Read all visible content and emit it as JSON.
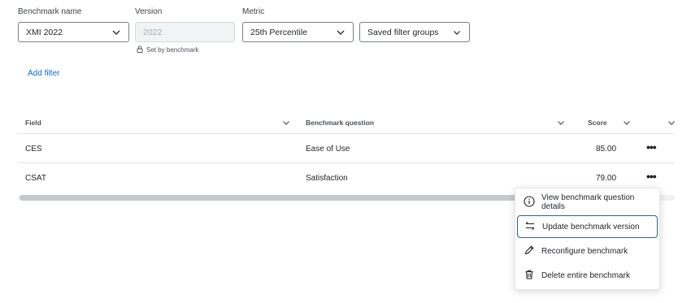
{
  "filters": {
    "benchmark_label": "Benchmark name",
    "benchmark_value": "XMI 2022",
    "version_label": "Version",
    "version_value": "2022",
    "version_note": "Set by benchmark",
    "metric_label": "Metric",
    "metric_value": "25th Percentile",
    "filter_groups_value": "Saved filter groups",
    "add_filter": "Add filter"
  },
  "table": {
    "headers": {
      "field": "Field",
      "question": "Benchmark question",
      "score": "Score"
    },
    "rows": [
      {
        "field": "CES",
        "question": "Ease of Use",
        "score": "85.00",
        "actions": "•••"
      },
      {
        "field": "CSAT",
        "question": "Satisfaction",
        "score": "79.00",
        "actions": "•••"
      }
    ]
  },
  "menu": {
    "items": [
      {
        "label": "View benchmark question details",
        "icon": "info-icon"
      },
      {
        "label": "Update benchmark version",
        "icon": "swap-icon"
      },
      {
        "label": "Reconfigure benchmark",
        "icon": "pencil-icon"
      },
      {
        "label": "Delete entire benchmark",
        "icon": "trash-icon"
      }
    ]
  },
  "colors": {
    "link": "#0b6bcb",
    "focus_border": "#355f8f"
  }
}
